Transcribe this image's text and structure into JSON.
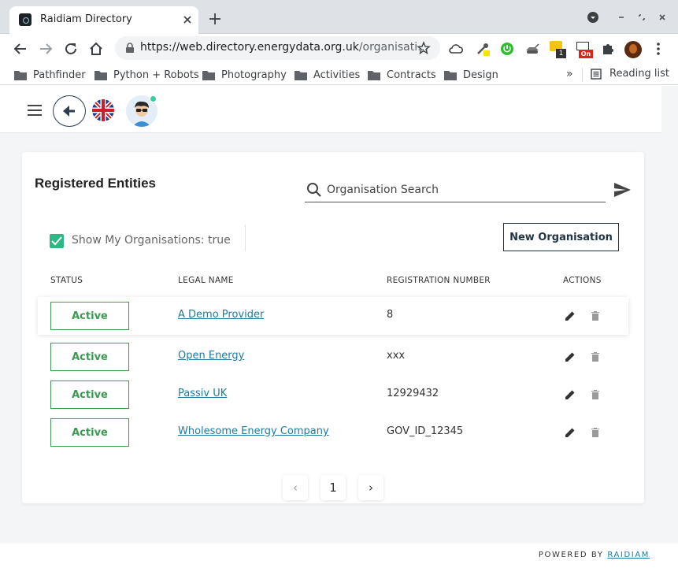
{
  "browser": {
    "tab_title": "Raidiam Directory",
    "url_host": "https://web.directory.energydata.org.uk",
    "url_path": "/organisati…",
    "extension_badge_count": "1",
    "extension_badge_on": "On",
    "bookmarks": [
      "Pathfinder",
      "Python + Robots",
      "Photography",
      "Activities",
      "Contracts",
      "Design"
    ],
    "bookmarks_more": "»",
    "reading_list": "Reading list"
  },
  "page": {
    "title": "Registered Entities",
    "search_placeholder": "Organisation Search",
    "show_my_orgs_label": "Show My Organisations: true",
    "show_my_orgs_checked": true,
    "new_org_button": "New Organisation",
    "columns": {
      "status": "STATUS",
      "legal_name": "LEGAL NAME",
      "registration_number": "REGISTRATION NUMBER",
      "actions": "ACTIONS"
    },
    "rows": [
      {
        "status": "Active",
        "legal_name": "A Demo Provider",
        "registration_number": "8"
      },
      {
        "status": "Active",
        "legal_name": "Open Energy",
        "registration_number": "xxx"
      },
      {
        "status": "Active",
        "legal_name": "Passiv UK",
        "registration_number": "12929432"
      },
      {
        "status": "Active",
        "legal_name": "Wholesome Energy Company",
        "registration_number": "GOV_ID_12345"
      }
    ],
    "pagination": {
      "current_page": "1",
      "prev": "‹",
      "next": "›"
    }
  },
  "footer": {
    "powered_by": "POWERED BY",
    "brand": "RAIDIAM"
  },
  "colors": {
    "accent": "#1f7a9e",
    "status_active": "#3a9a52",
    "checkbox": "#2eb883",
    "dark": "#1e3346"
  }
}
